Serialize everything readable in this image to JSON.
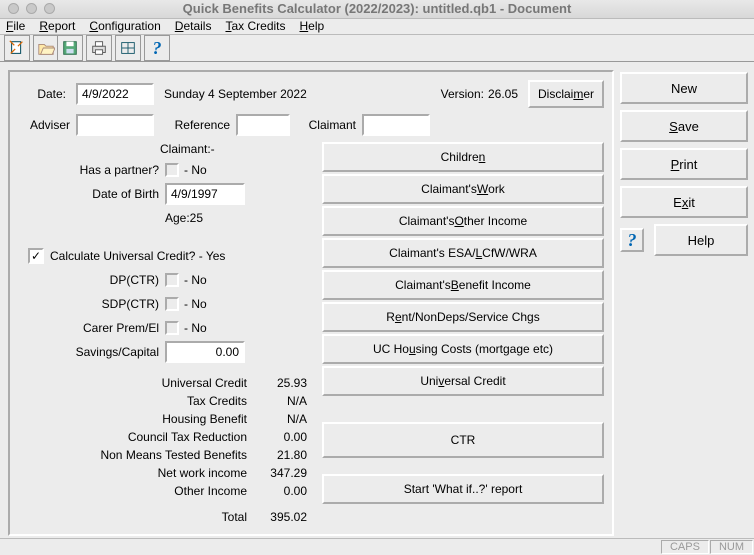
{
  "window": {
    "title": "Quick Benefits Calculator (2022/2023): untitled.qb1 - Document"
  },
  "menu": {
    "file": "File",
    "report": "Report",
    "config": "Configuration",
    "details": "Details",
    "tax": "Tax Credits",
    "help": "Help"
  },
  "header": {
    "date_lbl": "Date:",
    "date_val": "4/9/2022",
    "date_long": "Sunday 4 September 2022",
    "version_lbl": "Version:",
    "version": "26.05",
    "disclaimer": "Disclaimer",
    "adviser_lbl": "Adviser",
    "reference_lbl": "Reference",
    "claimant_lbl": "Claimant"
  },
  "claimant": {
    "heading": "Claimant:-",
    "partner_lbl": "Has a partner?",
    "partner_val": "- No",
    "dob_lbl": "Date of Birth",
    "dob_val": "4/9/1997",
    "age_lbl": "Age:25",
    "uc_lbl": "Calculate Universal Credit? - Yes",
    "dp_lbl": "DP(CTR)",
    "dp_val": "- No",
    "sdp_lbl": "SDP(CTR)",
    "sdp_val": "- No",
    "carer_lbl": "Carer Prem/El",
    "carer_val": "- No",
    "savings_lbl": "Savings/Capital",
    "savings_val": "0.00"
  },
  "results": {
    "uc_lbl": "Universal Credit",
    "uc_val": "25.93",
    "tc_lbl": "Tax Credits",
    "tc_val": "N/A",
    "hb_lbl": "Housing Benefit",
    "hb_val": "N/A",
    "ctr_lbl": "Council Tax Reduction",
    "ctr_val": "0.00",
    "nmt_lbl": "Non Means Tested Benefits",
    "nmt_val": "21.80",
    "net_lbl": "Net work income",
    "net_val": "347.29",
    "other_lbl": "Other Income",
    "other_val": "0.00",
    "total_lbl": "Total",
    "total_val": "395.02"
  },
  "nav": {
    "children": "Children",
    "work": "Claimant's Work",
    "other": "Claimant's Other Income",
    "esa": "Claimant's ESA/LCfW/WRA",
    "benefit": "Claimant's Benefit Income",
    "rent": "Rent/NonDeps/Service Chgs",
    "housing": "UC Housing Costs (mortgage etc)",
    "uc": "Universal Credit",
    "ctr": "CTR",
    "whatif": "Start 'What if..?' report"
  },
  "side": {
    "new": "New",
    "save": "Save",
    "print": "Print",
    "exit": "Exit",
    "help": "Help"
  },
  "status": {
    "caps": "CAPS",
    "num": "NUM"
  }
}
